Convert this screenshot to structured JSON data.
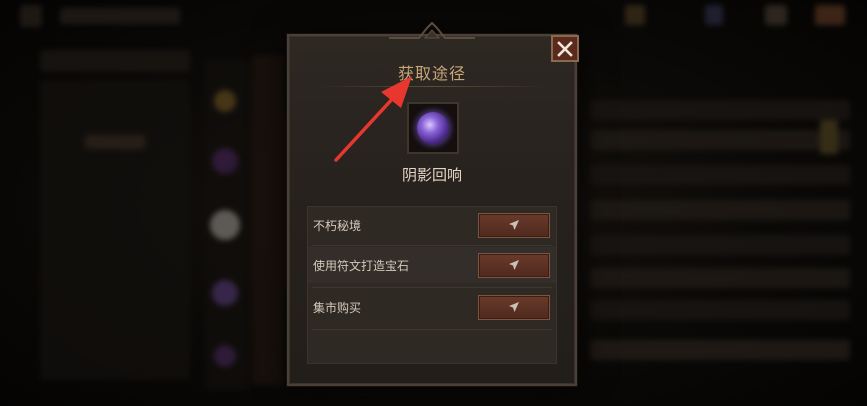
{
  "dialog": {
    "title": "获取途径",
    "item_name": "阴影回响",
    "close_icon": "close-icon",
    "sources": [
      {
        "label": "不朽秘境",
        "button_icon": "navigate-arrow-icon"
      },
      {
        "label": "使用符文打造宝石",
        "button_icon": "navigate-arrow-icon"
      },
      {
        "label": "集市购买",
        "button_icon": "navigate-arrow-icon"
      }
    ]
  },
  "annotation": {
    "arrow_color": "#e8372e"
  },
  "colors": {
    "title": "#c9a67a",
    "close_button": "#5a2a1c",
    "goto_button": "#5a3122",
    "orb": "#8a63d8"
  }
}
